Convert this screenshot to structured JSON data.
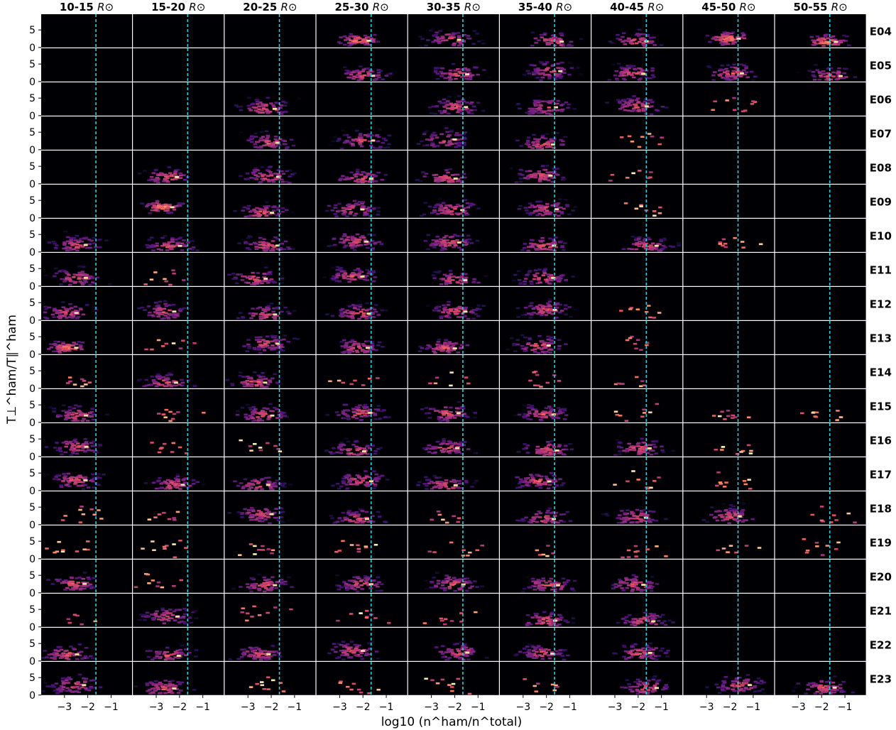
{
  "chart_data": {
    "type": "heatmap",
    "description_kind": "2D histogram grid",
    "xlabel": "log10 (n^ham/n^total)",
    "ylabel": "T⊥^ham/T∥^ham",
    "columns": [
      {
        "label": "10-15",
        "unit": "R⊙"
      },
      {
        "label": "15-20",
        "unit": "R⊙"
      },
      {
        "label": "20-25",
        "unit": "R⊙"
      },
      {
        "label": "25-30",
        "unit": "R⊙"
      },
      {
        "label": "30-35",
        "unit": "R⊙"
      },
      {
        "label": "35-40",
        "unit": "R⊙"
      },
      {
        "label": "40-45",
        "unit": "R⊙"
      },
      {
        "label": "45-50",
        "unit": "R⊙"
      },
      {
        "label": "50-55",
        "unit": "R⊙"
      }
    ],
    "rows": [
      "E04",
      "E05",
      "E06",
      "E07",
      "E08",
      "E09",
      "E10",
      "E11",
      "E12",
      "E13",
      "E14",
      "E15",
      "E16",
      "E17",
      "E18",
      "E19",
      "E20",
      "E21",
      "E22",
      "E23"
    ],
    "xticks": [
      "−3",
      "−2",
      "−1"
    ],
    "xtick_values": [
      -3,
      -2,
      -1
    ],
    "yticks": [
      "0",
      "5"
    ],
    "ytick_values": [
      0,
      5
    ],
    "xlim": [
      -4.0,
      -0.1
    ],
    "ylim": [
      0,
      9.5
    ],
    "reference_line_x": -1.65,
    "reference_line_color": "#25d0df",
    "colormap": "magma",
    "background_color": "#000004",
    "density": [
      [
        0,
        0,
        0,
        3,
        2,
        2,
        2,
        3,
        3
      ],
      [
        0,
        0,
        0,
        2,
        2,
        2,
        2,
        2,
        2
      ],
      [
        0,
        0,
        2,
        0,
        2,
        2,
        2,
        1,
        0
      ],
      [
        0,
        0,
        2,
        2,
        2,
        2,
        1,
        0,
        0
      ],
      [
        0,
        2,
        2,
        2,
        2,
        2,
        1,
        0,
        0
      ],
      [
        0,
        3,
        2,
        2,
        2,
        2,
        1,
        0,
        0
      ],
      [
        2,
        2,
        2,
        2,
        2,
        2,
        2,
        1,
        0
      ],
      [
        2,
        1,
        2,
        2,
        2,
        2,
        0,
        0,
        0
      ],
      [
        2,
        2,
        2,
        2,
        2,
        2,
        1,
        0,
        0
      ],
      [
        3,
        1,
        2,
        2,
        2,
        2,
        1,
        0,
        0
      ],
      [
        1,
        2,
        2,
        1,
        1,
        1,
        1,
        0,
        0
      ],
      [
        2,
        1,
        2,
        2,
        2,
        2,
        1,
        1,
        1
      ],
      [
        2,
        1,
        1,
        2,
        2,
        2,
        2,
        1,
        0
      ],
      [
        2,
        2,
        2,
        2,
        2,
        2,
        1,
        1,
        0
      ],
      [
        1,
        1,
        2,
        2,
        1,
        2,
        2,
        2,
        1
      ],
      [
        1,
        1,
        1,
        1,
        1,
        1,
        1,
        1,
        1
      ],
      [
        2,
        1,
        2,
        2,
        2,
        2,
        2,
        0,
        0
      ],
      [
        1,
        2,
        1,
        1,
        1,
        2,
        2,
        0,
        0
      ],
      [
        2,
        2,
        2,
        2,
        2,
        2,
        2,
        0,
        0
      ],
      [
        2,
        2,
        1,
        1,
        1,
        1,
        2,
        2,
        2
      ]
    ],
    "grid": false
  }
}
